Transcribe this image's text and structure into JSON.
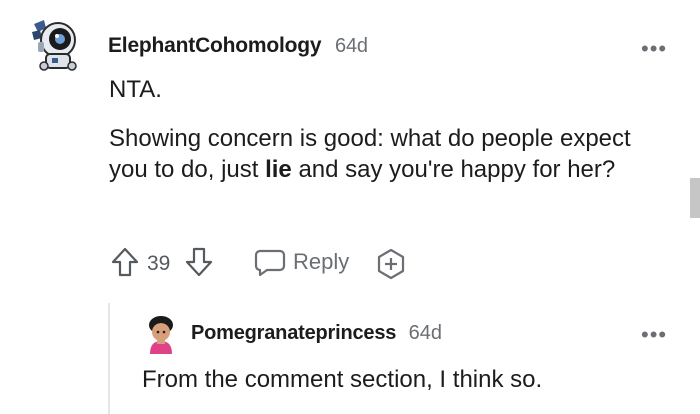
{
  "comment": {
    "username": "ElephantCohomology",
    "age": "64d",
    "line1": "NTA.",
    "para_before": "Showing concern is good: what do people expect you to do, just ",
    "para_bold": "lie",
    "para_after": " and say you're happy for her?",
    "votes": "39",
    "reply_label": "Reply",
    "more_label": "•••"
  },
  "reply": {
    "username": "Pomegranateprincess",
    "age": "64d",
    "text": "From the comment section, I think so.",
    "more_label": "•••"
  },
  "colors": {
    "primary_text": "#1c1c1c",
    "secondary_text": "#6b6f73",
    "thread_line": "#e4e6e8",
    "scrollbar": "#c6c6c6"
  },
  "icons": {
    "upvote": "arrow-up-icon",
    "downvote": "arrow-down-icon",
    "reply": "speech-bubble-icon",
    "award": "plus-badge-icon",
    "more": "ellipsis-icon"
  }
}
